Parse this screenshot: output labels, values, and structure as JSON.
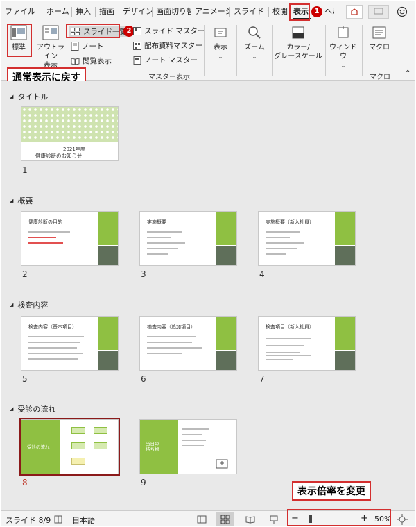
{
  "tabs": [
    "ファイル",
    "ホーム",
    "挿入",
    "描画",
    "デザイン",
    "画面切り替",
    "アニメーション",
    "スライド ショー",
    "校閲",
    "表示",
    "ヘルプ"
  ],
  "badges": {
    "one": "1",
    "two": "2"
  },
  "ribbon": {
    "normal": "標準",
    "outline": "アウトライン\n表示",
    "slide_sorter": "スライド一覧",
    "notes": "ノート",
    "reading": "閲覧表示",
    "slide_master": "スライド マスター",
    "handout_master": "配布資料マスター",
    "notes_master": "ノート マスター",
    "master_group": "マスター表示",
    "show": "表示",
    "zoom": "ズーム",
    "color": "カラー/\nグレースケール",
    "window": "ウィンドウ",
    "macro": "マクロ",
    "macro_group": "マクロ"
  },
  "callouts": {
    "normal": "通常表示に戻す",
    "zoom": "表示倍率を変更"
  },
  "sections": [
    "タイトル",
    "概要",
    "検査内容",
    "受診の流れ"
  ],
  "slides": {
    "s1": {
      "num": "1",
      "line1": "2021年度",
      "line2": "健康診断のお知らせ"
    },
    "s2": {
      "num": "2",
      "title": "健康診断の目的"
    },
    "s3": {
      "num": "3",
      "title": "実施概要"
    },
    "s4": {
      "num": "4",
      "title": "実施概要（新入社員）"
    },
    "s5": {
      "num": "5",
      "title": "検査内容（基本項目）"
    },
    "s6": {
      "num": "6",
      "title": "検査内容（追加項目）"
    },
    "s7": {
      "num": "7",
      "title": "検査項目（新入社員）"
    },
    "s8": {
      "num": "8",
      "title": "受診の流れ"
    },
    "s9": {
      "num": "9",
      "title": "当日の\n持ち物"
    }
  },
  "status": {
    "slide": "スライド 8/9",
    "lang": "日本語",
    "zoom": "50%",
    "minus": "−",
    "plus": "+"
  },
  "colors": {
    "accent": "#8fc042",
    "dark": "#5f6f5a",
    "callout": "#d32f2f",
    "selected": "#8b1a1a"
  }
}
